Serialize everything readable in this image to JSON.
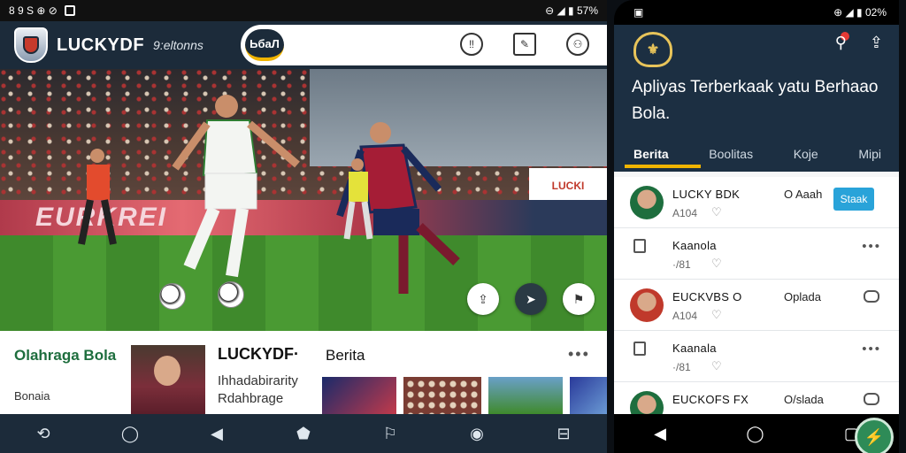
{
  "tablet": {
    "statusbar": {
      "left": "8 9 S ⊕ ⊘",
      "right": "⊖ ◢ ▮ 57%"
    },
    "brand": {
      "name": "LUCKYDF",
      "subtitle": "9:eltonns"
    },
    "search_button": "ЬбаЛ",
    "top_icons": [
      "clock-icon",
      "edit-icon",
      "user-icon"
    ],
    "hero": {
      "ad_text": "EURKREI",
      "stand_sign": "LUCKI"
    },
    "hero_actions": [
      "share-icon",
      "send-icon",
      "bookmark-icon"
    ],
    "lower": {
      "category_title": "Olahraga Bola",
      "category_sub": "Bonaia",
      "card_title": "LUCKYDF·",
      "card_sub1": "Ihhadabirarity",
      "card_sub2": "Rdahbrage",
      "berita_title": "Berita",
      "more": "•••"
    },
    "navbar": [
      "back-icon",
      "chat-icon",
      "play-icon",
      "home-icon",
      "bookmark-icon",
      "circle-icon",
      "profile-icon"
    ]
  },
  "phone": {
    "statusbar": {
      "left": "▣",
      "right": "⊕ ◢ ▮ 02%"
    },
    "headline": "Apliyas Terberkaak yatu Berhaao Bola.",
    "tabs": [
      "Berita",
      "Boolitas",
      "Koje",
      "Mipi"
    ],
    "active_tab": "Berita",
    "rows": [
      {
        "type": "avatar",
        "name": "LUCKY BDK",
        "meta": "A104",
        "action": "O Aaah",
        "button": "Staak"
      },
      {
        "type": "doc",
        "name": "Kaanola",
        "meta": "·/81",
        "more": "•••"
      },
      {
        "type": "avatar-red",
        "name": "EUCKVBS O",
        "meta": "A104",
        "action": "Oplada"
      },
      {
        "type": "doc",
        "name": "Kaanala",
        "meta": "·/81",
        "more": "•••"
      },
      {
        "type": "avatar",
        "name": "EUCKOFS FX",
        "meta": "",
        "action": "O/slada"
      }
    ],
    "nav": [
      "back-icon",
      "home-icon",
      "recents-icon"
    ],
    "colors": {
      "header": "#1c2f42",
      "accent": "#f0b400",
      "follow": "#29a3d9"
    }
  }
}
